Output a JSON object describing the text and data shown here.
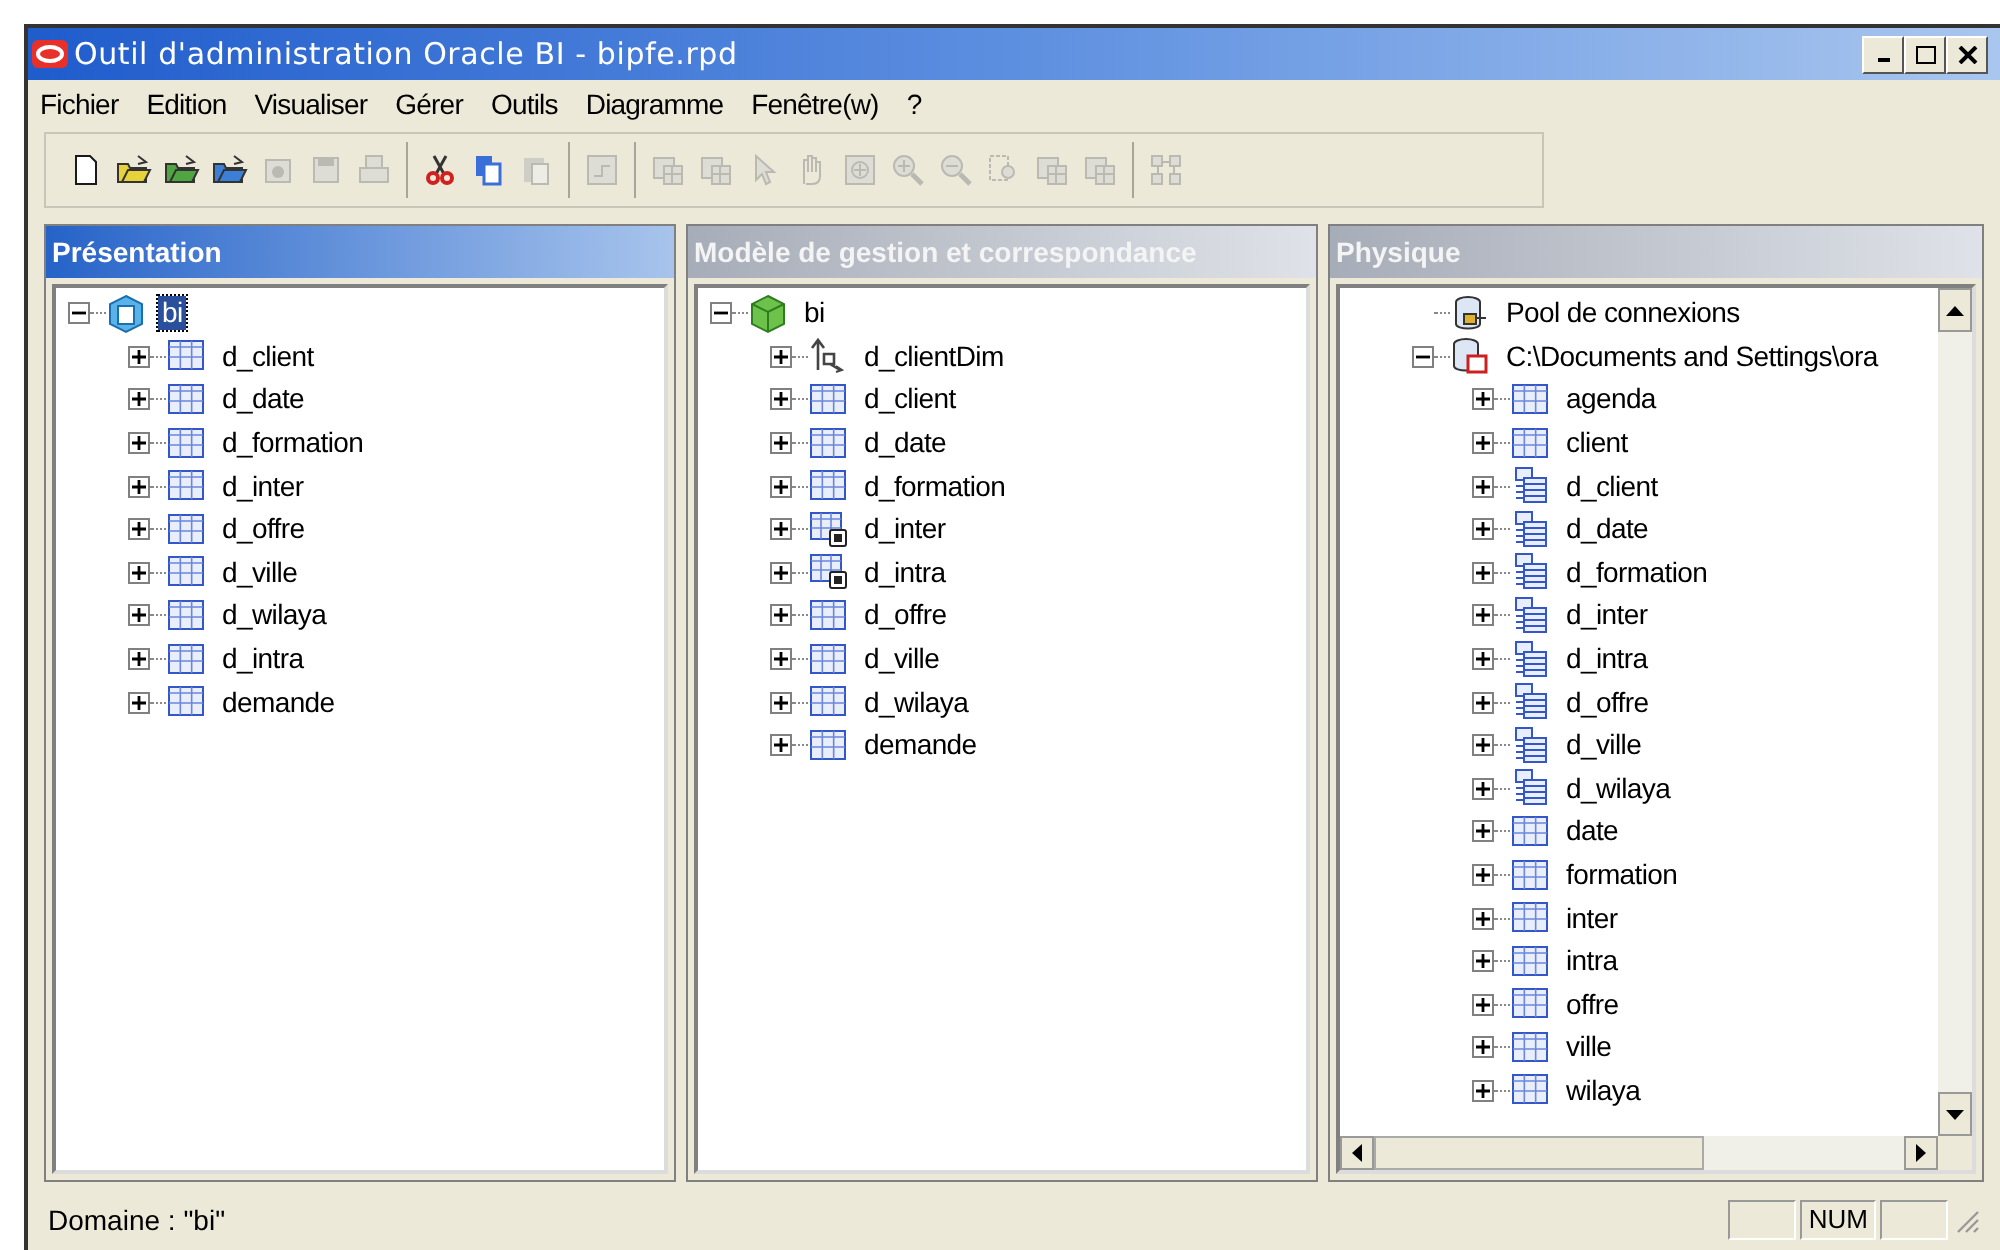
{
  "window": {
    "title": "Outil d'administration Oracle BI - bipfe.rpd"
  },
  "menu": [
    "Fichier",
    "Edition",
    "Visualiser",
    "Gérer",
    "Outils",
    "Diagramme",
    "Fenêtre(w)",
    "?"
  ],
  "toolbar": [
    {
      "kind": "new",
      "disabled": false
    },
    {
      "kind": "open-yellow",
      "disabled": false
    },
    {
      "kind": "open-green",
      "disabled": false
    },
    {
      "kind": "open-blue",
      "disabled": false
    },
    {
      "kind": "import",
      "disabled": true
    },
    {
      "kind": "save",
      "disabled": true
    },
    {
      "kind": "print",
      "disabled": true
    },
    {
      "kind": "separator"
    },
    {
      "kind": "cut",
      "disabled": false
    },
    {
      "kind": "copy",
      "disabled": false
    },
    {
      "kind": "paste",
      "disabled": true
    },
    {
      "kind": "separator"
    },
    {
      "kind": "window",
      "disabled": true
    },
    {
      "kind": "separator"
    },
    {
      "kind": "table-add",
      "disabled": true
    },
    {
      "kind": "grid",
      "disabled": true
    },
    {
      "kind": "pointer",
      "disabled": true
    },
    {
      "kind": "hand",
      "disabled": true
    },
    {
      "kind": "zoom-fit",
      "disabled": true
    },
    {
      "kind": "zoom-in",
      "disabled": true
    },
    {
      "kind": "zoom-out",
      "disabled": true
    },
    {
      "kind": "select",
      "disabled": true
    },
    {
      "kind": "join",
      "disabled": true
    },
    {
      "kind": "join-complex",
      "disabled": true
    },
    {
      "kind": "separator"
    },
    {
      "kind": "network",
      "disabled": true
    }
  ],
  "panes": [
    {
      "title": "Présentation",
      "active": true,
      "items": [
        {
          "label": "bi",
          "kind": "catalog",
          "expanded": true,
          "selected": true,
          "children": [
            {
              "label": "d_client",
              "kind": "table",
              "expanded": false,
              "selected": false
            },
            {
              "label": "d_date",
              "kind": "table",
              "expanded": false,
              "selected": false
            },
            {
              "label": "d_formation",
              "kind": "table",
              "expanded": false,
              "selected": false
            },
            {
              "label": "d_inter",
              "kind": "table",
              "expanded": false,
              "selected": false
            },
            {
              "label": "d_offre",
              "kind": "table",
              "expanded": false,
              "selected": false
            },
            {
              "label": "d_ville",
              "kind": "table",
              "expanded": false,
              "selected": false
            },
            {
              "label": "d_wilaya",
              "kind": "table",
              "expanded": false,
              "selected": false
            },
            {
              "label": "d_intra",
              "kind": "table",
              "expanded": false,
              "selected": false
            },
            {
              "label": "demande",
              "kind": "table",
              "expanded": false,
              "selected": false
            }
          ]
        }
      ]
    },
    {
      "title": "Modèle de gestion et correspondance",
      "active": false,
      "items": [
        {
          "label": "bi",
          "kind": "business-model",
          "expanded": true,
          "selected": false,
          "children": [
            {
              "label": "d_clientDim",
              "kind": "dimension",
              "expanded": false,
              "selected": false
            },
            {
              "label": "d_client",
              "kind": "table",
              "expanded": false,
              "selected": false
            },
            {
              "label": "d_date",
              "kind": "table",
              "expanded": false,
              "selected": false
            },
            {
              "label": "d_formation",
              "kind": "table",
              "expanded": false,
              "selected": false
            },
            {
              "label": "d_inter",
              "kind": "fact-table",
              "expanded": false,
              "selected": false
            },
            {
              "label": "d_intra",
              "kind": "fact-table",
              "expanded": false,
              "selected": false
            },
            {
              "label": "d_offre",
              "kind": "table",
              "expanded": false,
              "selected": false
            },
            {
              "label": "d_ville",
              "kind": "table",
              "expanded": false,
              "selected": false
            },
            {
              "label": "d_wilaya",
              "kind": "table",
              "expanded": false,
              "selected": false
            },
            {
              "label": "demande",
              "kind": "table",
              "expanded": false,
              "selected": false
            }
          ]
        }
      ]
    },
    {
      "title": "Physique",
      "active": false,
      "items": [
        {
          "label": "Pool de connexions",
          "kind": "connection-pool",
          "selected": false
        },
        {
          "label": "C:\\Documents and Settings\\ora",
          "kind": "database",
          "expanded": true,
          "selected": false,
          "children": [
            {
              "label": "agenda",
              "kind": "table",
              "expanded": false,
              "selected": false
            },
            {
              "label": "client",
              "kind": "table",
              "expanded": false,
              "selected": false
            },
            {
              "label": "d_client",
              "kind": "alias-table",
              "expanded": false,
              "selected": false
            },
            {
              "label": "d_date",
              "kind": "alias-table",
              "expanded": false,
              "selected": false
            },
            {
              "label": "d_formation",
              "kind": "alias-table",
              "expanded": false,
              "selected": false
            },
            {
              "label": "d_inter",
              "kind": "alias-table",
              "expanded": false,
              "selected": false
            },
            {
              "label": "d_intra",
              "kind": "alias-table",
              "expanded": false,
              "selected": false
            },
            {
              "label": "d_offre",
              "kind": "alias-table",
              "expanded": false,
              "selected": false
            },
            {
              "label": "d_ville",
              "kind": "alias-table",
              "expanded": false,
              "selected": false
            },
            {
              "label": "d_wilaya",
              "kind": "alias-table",
              "expanded": false,
              "selected": false
            },
            {
              "label": "date",
              "kind": "table",
              "expanded": false,
              "selected": false
            },
            {
              "label": "formation",
              "kind": "table",
              "expanded": false,
              "selected": false
            },
            {
              "label": "inter",
              "kind": "table",
              "expanded": false,
              "selected": false
            },
            {
              "label": "intra",
              "kind": "table",
              "expanded": false,
              "selected": false
            },
            {
              "label": "offre",
              "kind": "table",
              "expanded": false,
              "selected": false
            },
            {
              "label": "ville",
              "kind": "table",
              "expanded": false,
              "selected": false
            },
            {
              "label": "wilaya",
              "kind": "table",
              "expanded": false,
              "selected": false
            }
          ]
        }
      ]
    }
  ],
  "status_bar": {
    "text": "Domaine : \"bi\"",
    "indicator": "NUM"
  }
}
